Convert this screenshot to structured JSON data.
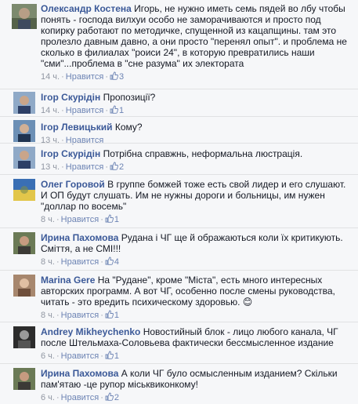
{
  "like_label": "Нравится",
  "comments": [
    {
      "author": "Олександр Костена",
      "text": "Игорь, не нужно иметь семь пядей во лбу чтобы понять - господа вилхуи особо не заморачиваются и просто под копирку работают по методичке, спущенной из кацапщины. там это пролезло давным давно, а они просто \"перенял опыт\". и проблема не сколько в филиалах \"роиси 24\", в которую превратились наши \"сми\"...проблема в \"сне разума\" их электората",
      "time": "14 ч.",
      "likes": "3"
    },
    {
      "author": "Ігор Скурідін",
      "text": "Пропозиції?",
      "time": "14 ч.",
      "likes": "1"
    },
    {
      "author": "Ігор Левицький",
      "text": "Кому?",
      "time": "13 ч.",
      "likes": ""
    },
    {
      "author": "Ігор Скурідін",
      "text": "Потрібна справжнь, неформальна люстрація.",
      "time": "13 ч.",
      "likes": "2"
    },
    {
      "author": "Олег Горовой",
      "text": "В группе бомжей тоже есть свой лидер и его слушают. И ОП будут слушать. Им не нужны дороги и больницы, им нужен \"доллар по восемь\"",
      "time": "8 ч.",
      "likes": "1"
    },
    {
      "author": "Ирина Пахомова",
      "text": "Рудана і ЧГ ще й ображаються коли їх критикують. Сміття, а не СМІ!!!",
      "time": "8 ч.",
      "likes": "4"
    },
    {
      "author": "Marina Gere",
      "text": "На \"Рудане\", кроме \"Міста\", есть много интересных авторских программ. А вот ЧГ, особенно после смены руководства, читать - это вредить психическому здоровью.",
      "emoji": "😊",
      "time": "8 ч.",
      "likes": "1"
    },
    {
      "author": "Andrey Mikheychenko",
      "text": "Новостийный блок - лицо любого канала, ЧГ после Штельмаха-Соловьева фактически бессмысленное издание",
      "time": "6 ч.",
      "likes": "1"
    },
    {
      "author": "Ирина Пахомова",
      "text": "А коли ЧГ було осмысленным изданием? Скільки пам'ятаю -це рупор міськвиконкому!",
      "time": "6 ч.",
      "likes": "2"
    }
  ],
  "colors": {
    "link": "#3b5998",
    "meta": "#9197a3",
    "background": "#f6f7f9"
  }
}
